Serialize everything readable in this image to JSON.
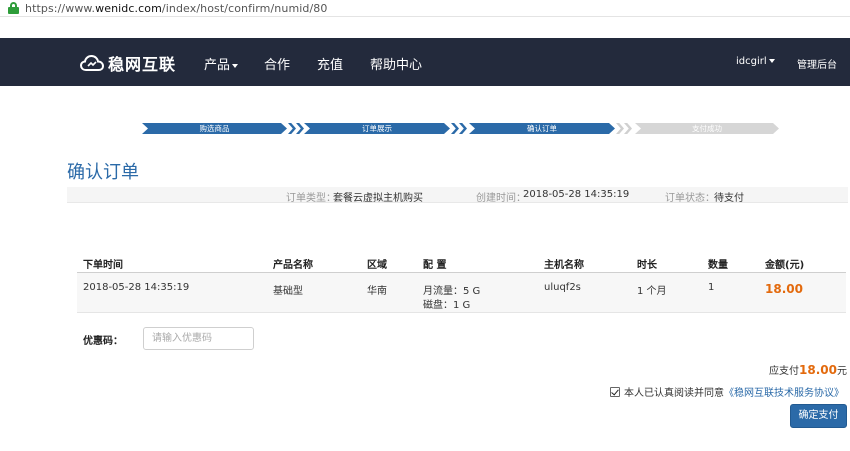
{
  "browser": {
    "url_prefix": "https://www.",
    "url_domain": "wenidc.com",
    "url_path": "/index/host/confirm/numid/80"
  },
  "nav": {
    "logo_text": "稳网互联",
    "items": [
      {
        "label": "产品",
        "has_caret": true
      },
      {
        "label": "合作"
      },
      {
        "label": "充值"
      },
      {
        "label": "帮助中心"
      }
    ],
    "user": "idcgirl",
    "admin": "管理后台"
  },
  "steps": [
    {
      "label": "购选商品",
      "state": "done"
    },
    {
      "label": "订单展示",
      "state": "done"
    },
    {
      "label": "确认订单",
      "state": "current"
    },
    {
      "label": "支付成功",
      "state": "pending"
    }
  ],
  "page_title": "确认订单",
  "order_info": {
    "type_label": "订单类型：",
    "type_value": "套餐云虚拟主机购买",
    "created_label": "创建时间：",
    "created_value": "2018-05-28 14:35:19",
    "status_label": "订单状态：",
    "status_value": "待支付"
  },
  "table": {
    "headers": [
      "下单时间",
      "产品名称",
      "区域",
      "配 置",
      "主机名称",
      "时长",
      "数量",
      "金额(元)"
    ],
    "rows": [
      {
        "time": "2018-05-28 14:35:19",
        "product": "基础型",
        "region": "华南",
        "config_1": "月流量：5 G",
        "config_2": "磁盘：1 G",
        "host": "uluqf2s",
        "duration": "1 个月",
        "qty": "1",
        "amount": "18.00"
      }
    ]
  },
  "coupon": {
    "label": "优惠码：",
    "placeholder": "请输入优惠码",
    "value": ""
  },
  "total": {
    "label": "应支付",
    "amount": "18.00",
    "unit": "元"
  },
  "agreement": {
    "text": "本人已认真阅读并同意",
    "link": "《稳网互联技术服务协议》",
    "checked": true
  },
  "pay_button": "确定支付",
  "colors": {
    "nav_bg": "#232a3c",
    "accent": "#2b6aa8",
    "price": "#e36a0d",
    "secure": "#2e9d3a"
  }
}
